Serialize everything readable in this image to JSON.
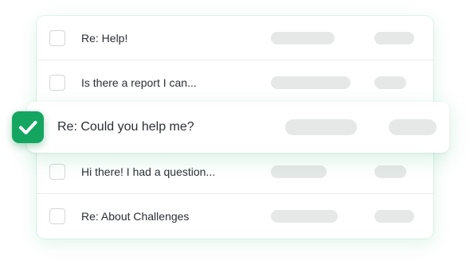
{
  "messages": [
    {
      "subject": "Re: Help!",
      "checked": false
    },
    {
      "subject": "Is there a report I can...",
      "checked": false
    },
    {
      "subject": "Re: Could you help me?",
      "checked": true
    },
    {
      "subject": "Hi there! I had a question...",
      "checked": false
    },
    {
      "subject": "Re: About Challenges",
      "checked": false
    }
  ],
  "icons": {
    "selected_check": "checkmark-icon"
  },
  "colors": {
    "accent": "#14a661",
    "placeholder": "#e6e8e7",
    "text": "#2b2f33"
  }
}
